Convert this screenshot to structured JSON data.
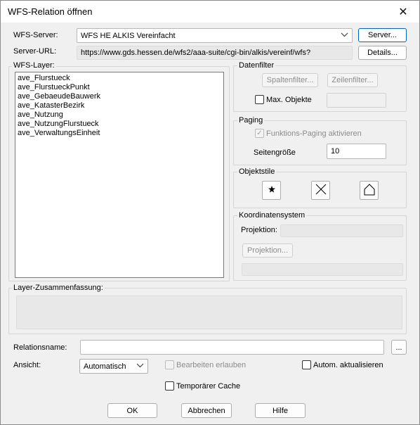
{
  "window": {
    "title": "WFS-Relation öffnen",
    "close_glyph": "✕"
  },
  "wfs_server": {
    "label": "WFS-Server:",
    "value": "WFS HE ALKIS Vereinfacht",
    "button": "Server..."
  },
  "server_url": {
    "label": "Server-URL:",
    "value": "https://www.gds.hessen.de/wfs2/aaa-suite/cgi-bin/alkis/vereinf/wfs?",
    "button": "Details..."
  },
  "layers": {
    "label": "WFS-Layer:",
    "items": [
      "ave_Flurstueck",
      "ave_FlurstueckPunkt",
      "ave_GebaeudeBauwerk",
      "ave_KatasterBezirk",
      "ave_Nutzung",
      "ave_NutzungFlurstueck",
      "ave_VerwaltungsEinheit"
    ]
  },
  "datenfilter": {
    "title": "Datenfilter",
    "spaltenfilter": "Spaltenfilter...",
    "zeilenfilter": "Zeilenfilter...",
    "max_objekte": "Max. Objekte"
  },
  "paging": {
    "title": "Paging",
    "funktions_paging": "Funktions-Paging aktivieren",
    "seitengroesse_label": "Seitengröße",
    "seitengroesse_value": "10"
  },
  "objektstile": {
    "title": "Objektstile",
    "icons": [
      "point-style-icon",
      "line-style-icon",
      "polygon-style-icon"
    ]
  },
  "koordinatensystem": {
    "title": "Koordinatensystem",
    "projektion_label": "Projektion:",
    "projektion_button": "Projektion..."
  },
  "zusammenfassung": {
    "label": "Layer-Zusammenfassung:"
  },
  "relationsname": {
    "label": "Relationsname:",
    "browse": "..."
  },
  "ansicht": {
    "label": "Ansicht:",
    "value": "Automatisch",
    "bearbeiten": "Bearbeiten erlauben",
    "autom": "Autom. aktualisieren"
  },
  "temp_cache": "Temporärer Cache",
  "buttons": {
    "ok": "OK",
    "abbrechen": "Abbrechen",
    "hilfe": "Hilfe"
  }
}
